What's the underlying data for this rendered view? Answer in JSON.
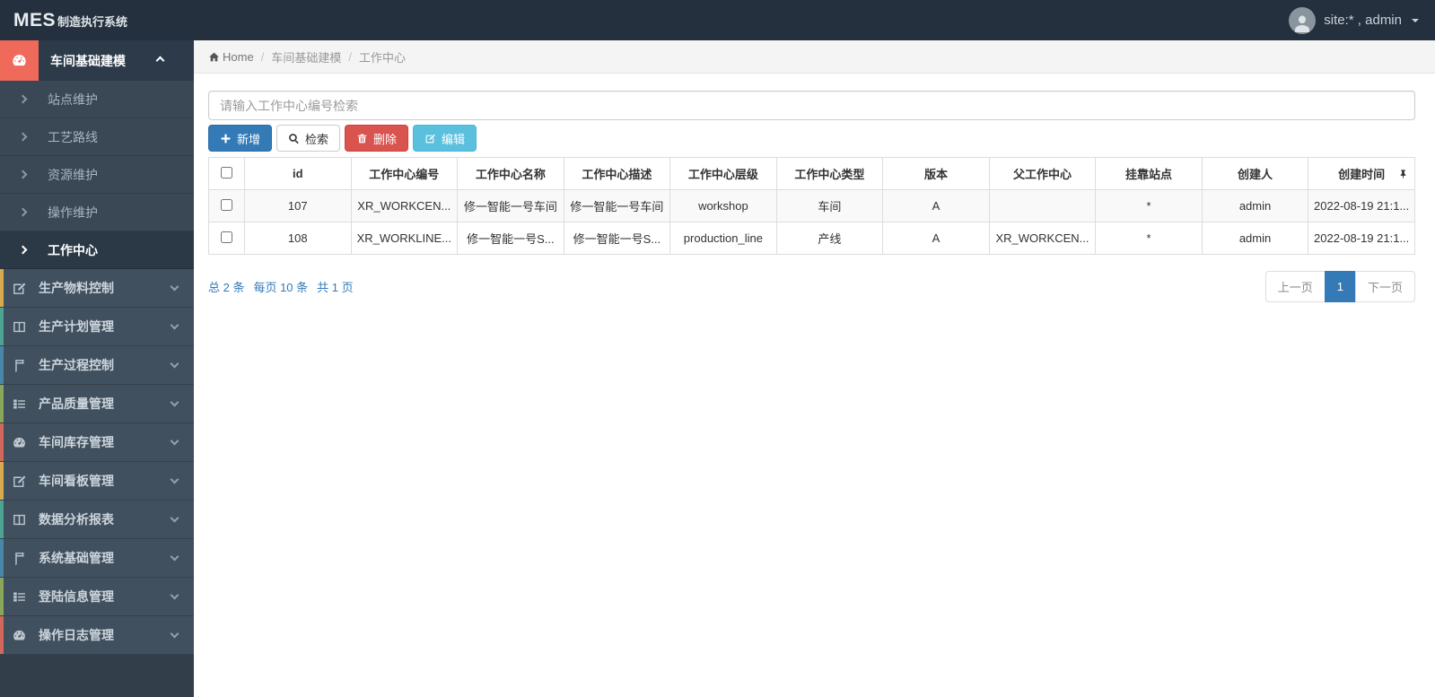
{
  "topbar": {
    "logo_bold": "MES",
    "logo_rest": "制造执行系统",
    "user_label": "site:* , admin"
  },
  "sidebar": {
    "parent_active": {
      "label": "车间基础建模"
    },
    "submenu": [
      {
        "label": "站点维护",
        "active": false
      },
      {
        "label": "工艺路线",
        "active": false
      },
      {
        "label": "资源维护",
        "active": false
      },
      {
        "label": "操作维护",
        "active": false
      },
      {
        "label": "工作中心",
        "active": true
      }
    ],
    "items": [
      {
        "label": "生产物料控制",
        "icon": "pencil-square-icon",
        "strip_color": "#d9a94e"
      },
      {
        "label": "生产计划管理",
        "icon": "columns-icon",
        "strip_color": "#4da394"
      },
      {
        "label": "生产过程控制",
        "icon": "book-icon",
        "strip_color": "#4b86a8"
      },
      {
        "label": "产品质量管理",
        "icon": "list-icon",
        "strip_color": "#8aa65a"
      },
      {
        "label": "车间库存管理",
        "icon": "tachometer-icon",
        "strip_color": "#d2685c"
      },
      {
        "label": "车间看板管理",
        "icon": "pencil-square-icon",
        "strip_color": "#d9a94e"
      },
      {
        "label": "数据分析报表",
        "icon": "columns-icon",
        "strip_color": "#4da394"
      },
      {
        "label": "系统基础管理",
        "icon": "book-icon",
        "strip_color": "#4b86a8"
      },
      {
        "label": "登陆信息管理",
        "icon": "list-icon",
        "strip_color": "#8aa65a"
      },
      {
        "label": "操作日志管理",
        "icon": "tachometer-icon",
        "strip_color": "#d2685c"
      }
    ]
  },
  "breadcrumb": {
    "home": "Home",
    "level1": "车间基础建模",
    "level2": "工作中心"
  },
  "toolbar": {
    "search_placeholder": "请输入工作中心编号检索",
    "add_label": "新增",
    "search_label": "检索",
    "delete_label": "删除",
    "edit_label": "编辑"
  },
  "table": {
    "columns": {
      "id": "id",
      "code": "工作中心编号",
      "name": "工作中心名称",
      "desc": "工作中心描述",
      "level": "工作中心层级",
      "type": "工作中心类型",
      "version": "版本",
      "parent": "父工作中心",
      "station": "挂靠站点",
      "creator": "创建人",
      "created": "创建时间"
    },
    "rows": [
      {
        "id": "107",
        "code": "XR_WORKCEN...",
        "name": "修一智能一号车间",
        "desc": "修一智能一号车间",
        "level": "workshop",
        "type": "车间",
        "version": "A",
        "parent": "",
        "station": "*",
        "creator": "admin",
        "created": "2022-08-19 21:1..."
      },
      {
        "id": "108",
        "code": "XR_WORKLINE...",
        "name": "修一智能一号S...",
        "desc": "修一智能一号S...",
        "level": "production_line",
        "type": "产线",
        "version": "A",
        "parent": "XR_WORKCEN...",
        "station": "*",
        "creator": "admin",
        "created": "2022-08-19 21:1..."
      }
    ]
  },
  "pagination": {
    "total": "总 2 条",
    "per_page": "每页 10 条",
    "pages": "共 1 页",
    "prev_label": "上一页",
    "current_page": "1",
    "next_label": "下一页"
  },
  "colors": {
    "topbar_bg": "#25303f",
    "sidebar_item_bg": "#41505e",
    "active_parent_red": "#ef6a5a",
    "primary_blue": "#337ab7",
    "danger_red": "#d9534f",
    "info_cyan": "#5bc0de",
    "strip_yellow": "#d9a94e",
    "strip_teal": "#4da394",
    "strip_blue": "#4b86a8",
    "strip_green": "#8aa65a",
    "strip_red": "#d2685c"
  }
}
